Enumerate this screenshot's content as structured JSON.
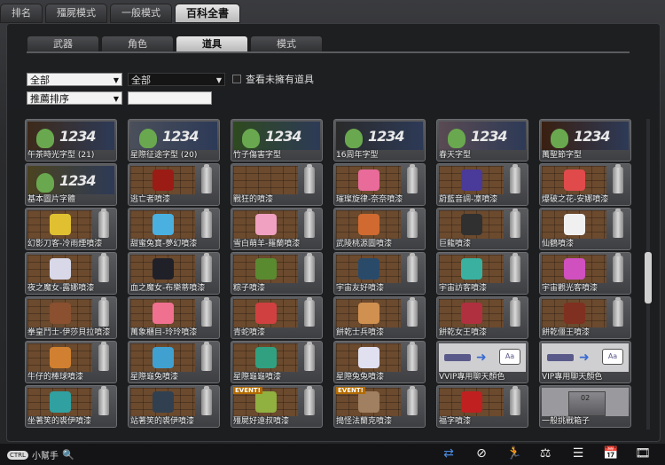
{
  "top_tabs": [
    {
      "label": "排名"
    },
    {
      "label": "殭屍模式"
    },
    {
      "label": "一般模式"
    },
    {
      "label": "百科全書",
      "active": true
    }
  ],
  "sub_tabs": [
    {
      "label": "武器"
    },
    {
      "label": "角色"
    },
    {
      "label": "道具",
      "active": true
    },
    {
      "label": "模式"
    }
  ],
  "filters": {
    "category": "全部",
    "subcategory": "全部",
    "sort": "推薦排序",
    "search_value": "",
    "show_unowned_label": "查看未擁有道具"
  },
  "items": [
    {
      "label": "午茶時光字型 (21)",
      "kind": "font",
      "color": "#3d2a1a"
    },
    {
      "label": "星際征途字型 (20)",
      "kind": "font",
      "color": "#4a4f5a"
    },
    {
      "label": "竹子傷害字型",
      "kind": "font",
      "color": "#2e4a1f"
    },
    {
      "label": "16周年字型",
      "kind": "font",
      "color": "#2a2a2a"
    },
    {
      "label": "春天字型",
      "kind": "font",
      "color": "#5a4a52"
    },
    {
      "label": "萬聖節字型",
      "kind": "font",
      "color": "#3a1f10"
    },
    {
      "label": "基本圖片字體",
      "kind": "font",
      "color": "#4b4320"
    },
    {
      "label": "逃亡者噴漆",
      "kind": "spray",
      "color": "#9a1c14"
    },
    {
      "label": "戰狂的噴漆",
      "kind": "spray",
      "color": ""
    },
    {
      "label": "璀璨旋律-奈奈噴漆",
      "kind": "spray",
      "color": "#e86b9a"
    },
    {
      "label": "蔚藍音調-凜噴漆",
      "kind": "spray",
      "color": "#4a3a9a"
    },
    {
      "label": "爆破之花-安娜噴漆",
      "kind": "spray",
      "color": "#e04a4a"
    },
    {
      "label": "幻影刀客-冷雨煙噴漆",
      "kind": "spray",
      "color": "#e0c030"
    },
    {
      "label": "甜蜜兔寶-夢幻噴漆",
      "kind": "spray",
      "color": "#4ab0e0"
    },
    {
      "label": "雪白萌羊-羅蘭噴漆",
      "kind": "spray",
      "color": "#f0a0c0"
    },
    {
      "label": "武陵桃源圖噴漆",
      "kind": "spray",
      "color": "#d06a30"
    },
    {
      "label": "巨龍噴漆",
      "kind": "spray",
      "color": "#303030"
    },
    {
      "label": "仙鶴噴漆",
      "kind": "spray",
      "color": "#f0f0f0"
    },
    {
      "label": "夜之魔女-露娜噴漆",
      "kind": "spray",
      "color": "#d8d8e8"
    },
    {
      "label": "血之魔女-布樂蒂噴漆",
      "kind": "spray",
      "color": "#202028"
    },
    {
      "label": "粽子噴漆",
      "kind": "spray",
      "color": "#5a8a30"
    },
    {
      "label": "宇宙友好噴漆",
      "kind": "spray",
      "color": "#2a4a6a"
    },
    {
      "label": "宇宙訪客噴漆",
      "kind": "spray",
      "color": "#3ab0a0"
    },
    {
      "label": "宇宙觀光客噴漆",
      "kind": "spray",
      "color": "#d050c0"
    },
    {
      "label": "拳皇鬥士-伊莎貝拉噴漆",
      "kind": "spray",
      "color": "#8a5030"
    },
    {
      "label": "萬象櫃目-玲玲噴漆",
      "kind": "spray",
      "color": "#f07090"
    },
    {
      "label": "青蛇噴漆",
      "kind": "spray",
      "color": "#d04040"
    },
    {
      "label": "餅乾士兵噴漆",
      "kind": "spray",
      "color": "#d09050"
    },
    {
      "label": "餅乾女王噴漆",
      "kind": "spray",
      "color": "#b03040"
    },
    {
      "label": "餅乾僵王噴漆",
      "kind": "spray",
      "color": "#803020"
    },
    {
      "label": "牛仔的棒球噴漆",
      "kind": "spray",
      "color": "#d08030"
    },
    {
      "label": "星際龜兔噴漆",
      "kind": "spray",
      "color": "#40a0d0"
    },
    {
      "label": "星際龜龜噴漆",
      "kind": "spray",
      "color": "#30a080"
    },
    {
      "label": "星際兔兔噴漆",
      "kind": "spray",
      "color": "#e0e0f0"
    },
    {
      "label": "VVIP專用聊天顏色",
      "kind": "chat",
      "color": ""
    },
    {
      "label": "VIP專用聊天顏色",
      "kind": "chat",
      "color": ""
    },
    {
      "label": "坐著笑的裘伊噴漆",
      "kind": "spray",
      "color": "#30a0a0"
    },
    {
      "label": "站著笑的裘伊噴漆",
      "kind": "spray",
      "color": "#304050"
    },
    {
      "label": "殭屍好遠叔噴漆",
      "kind": "spray",
      "color": "#90b040",
      "event": "EVENT!"
    },
    {
      "label": "搗怪法蘭克噴漆",
      "kind": "spray",
      "color": "#a08060",
      "event": "EVENT!"
    },
    {
      "label": "福字噴漆",
      "kind": "spray",
      "color": "#c02020"
    },
    {
      "label": "一般挑戰箱子",
      "kind": "box",
      "color": ""
    }
  ],
  "font_nums": "1234",
  "chat_badge": "Aa",
  "box_number": "02",
  "bottom": {
    "pill": "CTRL",
    "help_label": "小幫手",
    "icons": [
      "swap-icon",
      "compass-icon",
      "runner-icon",
      "scale-icon",
      "list-icon",
      "calendar-icon",
      "film-icon"
    ]
  }
}
